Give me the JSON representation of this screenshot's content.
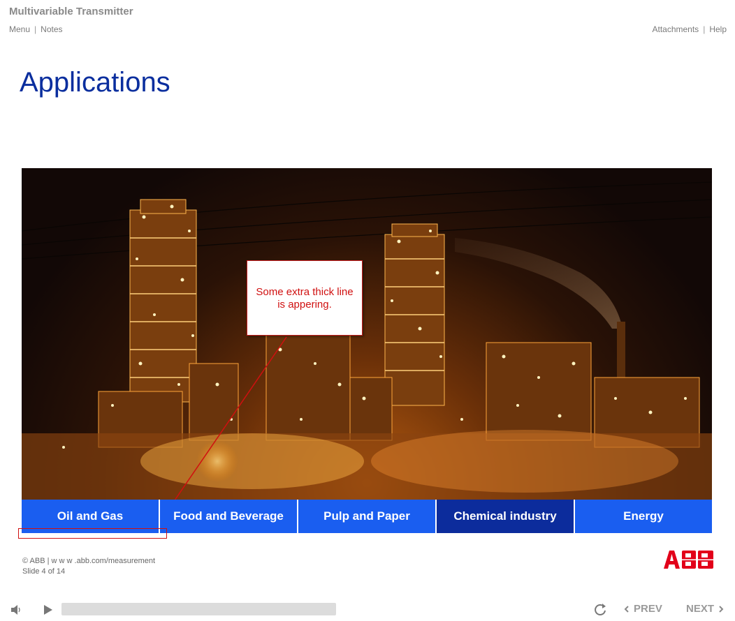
{
  "header": {
    "app_title": "Multivariable Transmitter",
    "left_nav": [
      "Menu",
      "Notes"
    ],
    "right_nav": [
      "Attachments",
      "Help"
    ]
  },
  "slide": {
    "title": "Applications",
    "tabs": [
      {
        "label": "Oil and Gas",
        "active": false
      },
      {
        "label": "Food and Beverage",
        "active": false
      },
      {
        "label": "Pulp and Paper",
        "active": false
      },
      {
        "label": "Chemical industry",
        "active": true
      },
      {
        "label": "Energy",
        "active": false
      }
    ]
  },
  "annotation": {
    "callout_line1": "Some extra thick line",
    "callout_line2": "is appering."
  },
  "footer": {
    "copyright": "© ABB | w w w .abb.com/measurement",
    "slide_counter": "Slide 4 of 14",
    "logo_text": "ABB"
  },
  "player": {
    "prev_label": "PREV",
    "next_label": "NEXT",
    "progress_fraction": 0.0
  },
  "colors": {
    "title_blue": "#0a2e9e",
    "tab_blue": "#1a5ef0",
    "tab_active": "#0c2c9c",
    "abb_red": "#e2001a",
    "annotation_red": "#d01010"
  },
  "icons": {
    "volume": "speaker-icon",
    "play": "play-icon",
    "replay": "replay-icon",
    "prev": "chevron-left-icon",
    "next": "chevron-right-icon"
  }
}
